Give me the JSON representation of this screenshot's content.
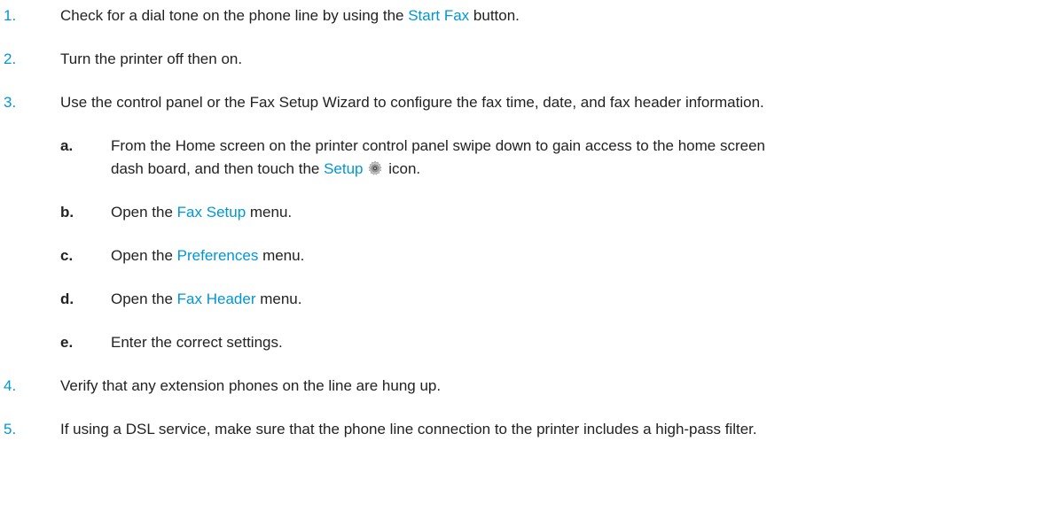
{
  "steps": [
    {
      "number": "1.",
      "text_before": "Check for a dial tone on the phone line by using the ",
      "link": "Start Fax",
      "text_after": " button."
    },
    {
      "number": "2.",
      "text": "Turn the printer off then on."
    },
    {
      "number": "3.",
      "text": "Use the control panel or the Fax Setup Wizard to configure the fax time, date, and fax header information.",
      "substeps": [
        {
          "letter": "a.",
          "line1": "From the Home screen on the printer control panel swipe down to gain access to the home screen",
          "line2_before": "dash board, and then touch the ",
          "link": "Setup",
          "icon": "setup-gear-icon",
          "line2_after": " icon."
        },
        {
          "letter": "b.",
          "text_before": "Open the ",
          "link": "Fax Setup",
          "text_after": " menu."
        },
        {
          "letter": "c.",
          "text_before": "Open the ",
          "link": "Preferences",
          "text_after": " menu."
        },
        {
          "letter": "d.",
          "text_before": "Open the ",
          "link": "Fax Header",
          "text_after": " menu."
        },
        {
          "letter": "e.",
          "text": "Enter the correct settings."
        }
      ]
    },
    {
      "number": "4.",
      "text": "Verify that any extension phones on the line are hung up."
    },
    {
      "number": "5.",
      "text": "If using a DSL service, make sure that the phone line connection to the printer includes a high-pass filter."
    }
  ],
  "colors": {
    "accent": "#0096d6",
    "text": "#222222"
  }
}
